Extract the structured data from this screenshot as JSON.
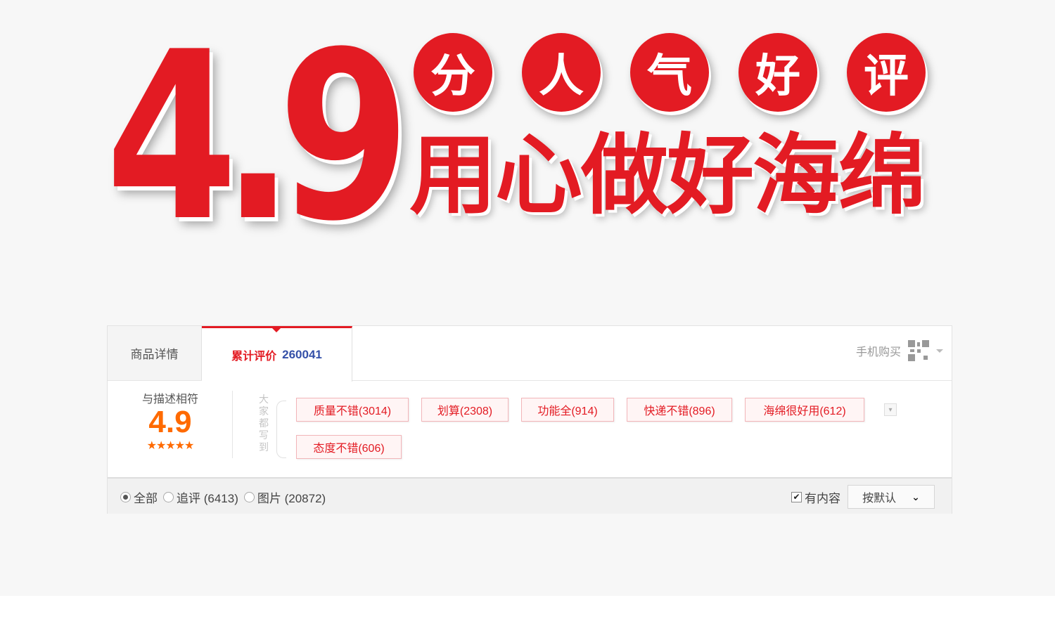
{
  "banner": {
    "score": "4.9",
    "circle_chars": [
      "分",
      "人",
      "气",
      "好",
      "评"
    ],
    "slogan": "用心做好海绵",
    "accent_color": "#e31b23"
  },
  "review_widget": {
    "tabs": {
      "detail_label": "商品详情",
      "reviews_label": "累计评价",
      "reviews_count": "260041"
    },
    "mobile_buy": {
      "label": "手机购买",
      "icon": "qr-code-icon"
    },
    "score": {
      "title": "与描述相符",
      "value": "4.9",
      "stars": "★★★★★",
      "rating_out_of_5": 5
    },
    "tags_caption": "大家都写到",
    "tags": [
      "质量不错(3014)",
      "划算(2308)",
      "功能全(914)",
      "快递不错(896)",
      "海绵很好用(612)",
      "态度不错(606)"
    ],
    "filters": {
      "all": "全部",
      "followup": "追评 (6413)",
      "images": "图片 (20872)",
      "selected": "全部"
    },
    "has_content": {
      "label": "有内容",
      "checked": true
    },
    "sort": {
      "selected": "按默认"
    }
  }
}
